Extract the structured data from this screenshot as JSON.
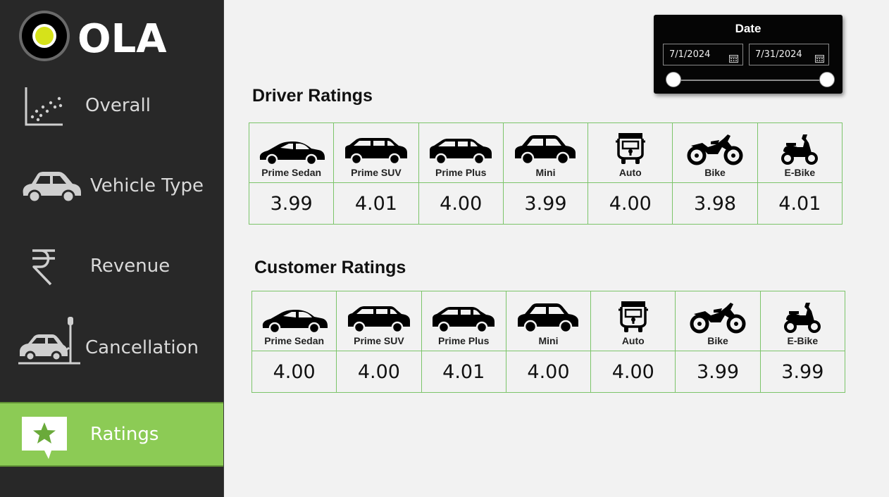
{
  "app": {
    "logo_text": "OLA",
    "accent": "#8ccb55",
    "sidebar_bg": "#282828",
    "grid_color": "#7cc46a"
  },
  "nav": [
    {
      "label": "Overall",
      "icon": "scatter-chart-icon",
      "active": false
    },
    {
      "label": "Vehicle Type",
      "icon": "car-icon",
      "active": false
    },
    {
      "label": "Revenue",
      "icon": "rupee-icon",
      "active": false
    },
    {
      "label": "Cancellation",
      "icon": "car-crash-icon",
      "active": false
    },
    {
      "label": "Ratings",
      "icon": "star-comment-icon",
      "active": true
    }
  ],
  "date_filter": {
    "title": "Date",
    "start": "7/1/2024",
    "end": "7/31/2024",
    "range_position": [
      0.0,
      1.0
    ]
  },
  "driver_ratings": {
    "title": "Driver Ratings",
    "vehicles": [
      {
        "label": "Prime Sedan",
        "icon": "sedan-icon",
        "value": "3.99"
      },
      {
        "label": "Prime SUV",
        "icon": "suv-icon",
        "value": "4.01"
      },
      {
        "label": "Prime Plus",
        "icon": "prime-plus-car-icon",
        "value": "4.00"
      },
      {
        "label": "Mini",
        "icon": "mini-car-icon",
        "value": "3.99"
      },
      {
        "label": "Auto",
        "icon": "auto-rickshaw-icon",
        "value": "4.00"
      },
      {
        "label": "Bike",
        "icon": "motorbike-icon",
        "value": "3.98"
      },
      {
        "label": "E-Bike",
        "icon": "scooter-icon",
        "value": "4.01"
      }
    ]
  },
  "customer_ratings": {
    "title": "Customer Ratings",
    "vehicles": [
      {
        "label": "Prime Sedan",
        "icon": "sedan-icon",
        "value": "4.00"
      },
      {
        "label": "Prime SUV",
        "icon": "suv-icon",
        "value": "4.00"
      },
      {
        "label": "Prime Plus",
        "icon": "prime-plus-car-icon",
        "value": "4.01"
      },
      {
        "label": "Mini",
        "icon": "mini-car-icon",
        "value": "4.00"
      },
      {
        "label": "Auto",
        "icon": "auto-rickshaw-icon",
        "value": "4.00"
      },
      {
        "label": "Bike",
        "icon": "motorbike-icon",
        "value": "3.99"
      },
      {
        "label": "E-Bike",
        "icon": "scooter-icon",
        "value": "3.99"
      }
    ]
  }
}
